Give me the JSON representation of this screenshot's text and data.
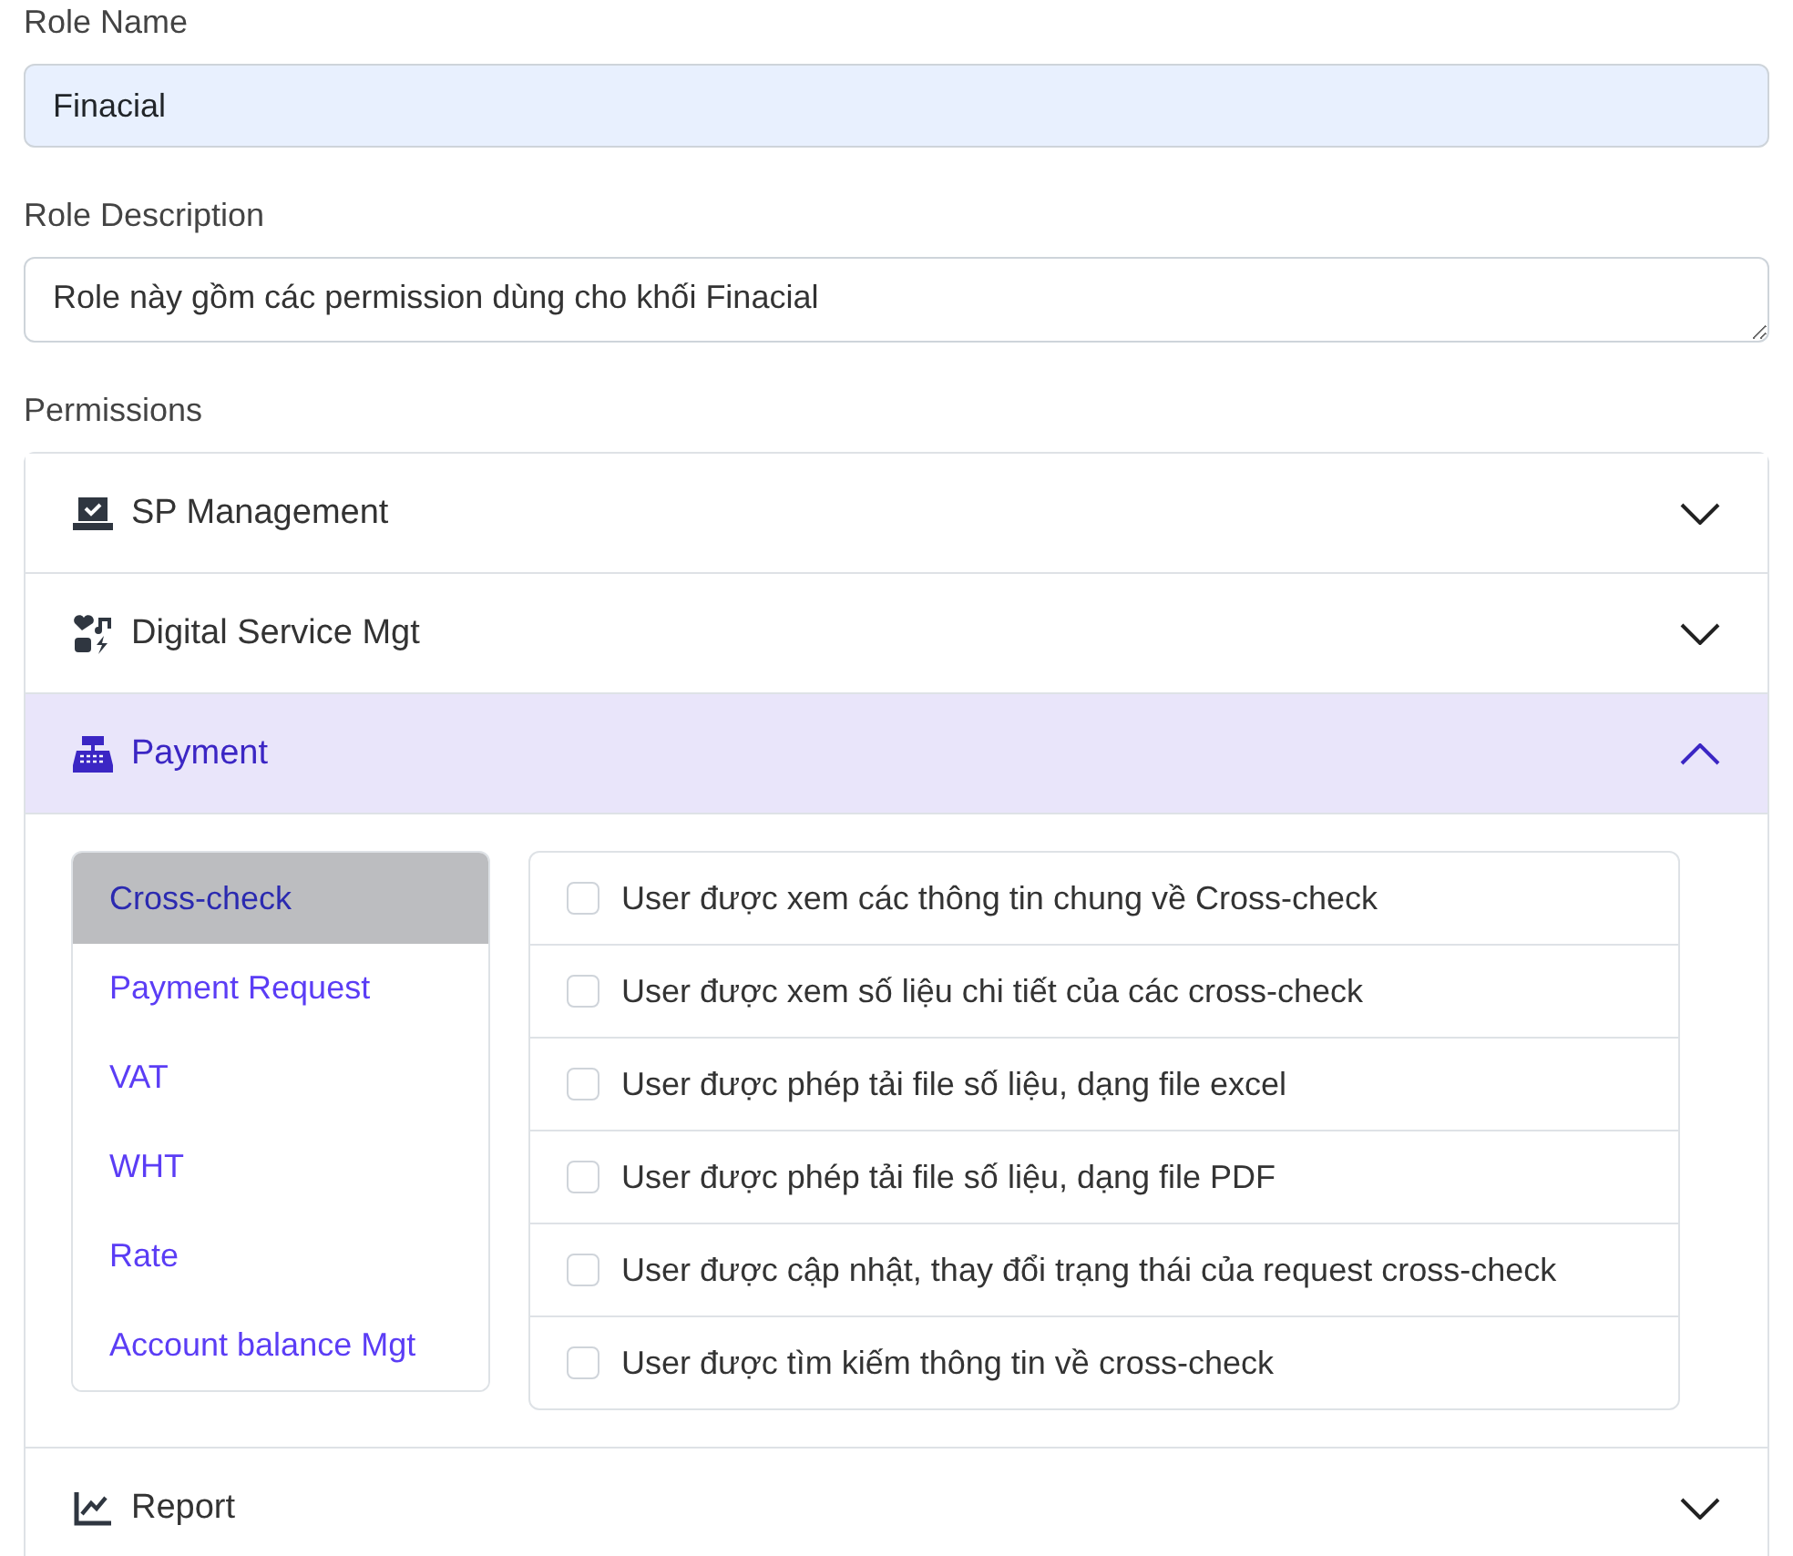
{
  "role_name": {
    "label": "Role Name",
    "value": "Finacial"
  },
  "role_description": {
    "label": "Role Description",
    "value": "Role này gồm các permission dùng cho khối Finacial"
  },
  "permissions": {
    "label": "Permissions",
    "sections": [
      {
        "title": "SP Management",
        "expanded": false
      },
      {
        "title": "Digital Service Mgt",
        "expanded": false
      },
      {
        "title": "Payment",
        "expanded": true,
        "subnav": [
          {
            "label": "Cross-check",
            "selected": true
          },
          {
            "label": "Payment Request",
            "selected": false
          },
          {
            "label": "VAT",
            "selected": false
          },
          {
            "label": "WHT",
            "selected": false
          },
          {
            "label": "Rate",
            "selected": false
          },
          {
            "label": "Account balance Mgt",
            "selected": false
          }
        ],
        "items": [
          {
            "label": "User được xem các thông tin chung về Cross-check",
            "checked": false
          },
          {
            "label": "User được xem số liệu chi tiết của các cross-check",
            "checked": false
          },
          {
            "label": "User được phép tải file số liệu, dạng file excel",
            "checked": false
          },
          {
            "label": "User được phép tải file số liệu, dạng file PDF",
            "checked": false
          },
          {
            "label": "User được cập nhật, thay đổi trạng thái của request cross-check",
            "checked": false
          },
          {
            "label": "User được tìm kiếm thông tin về cross-check",
            "checked": false
          }
        ]
      },
      {
        "title": "Report",
        "expanded": false
      }
    ]
  }
}
